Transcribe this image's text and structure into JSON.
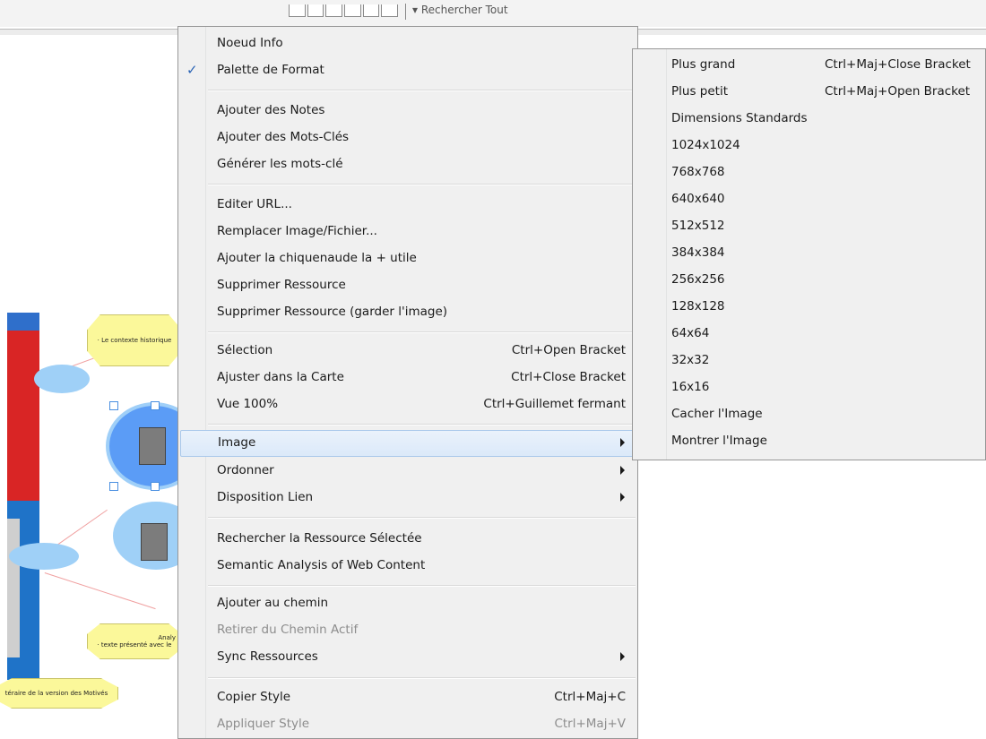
{
  "toolbar": {
    "search_label": "▾ Rechercher Tout"
  },
  "map": {
    "node_texts": [
      "· Le contexte historique",
      "Analy",
      "· texte présenté avec le",
      "téraire de la version des Motivés"
    ]
  },
  "menu": {
    "items": [
      {
        "label": "Noeud Info"
      },
      {
        "label": "Palette de Format",
        "checked": true
      },
      {
        "label": "Ajouter des Notes"
      },
      {
        "label": "Ajouter des Mots-Clés"
      },
      {
        "label": "Générer les mots-clé"
      },
      {
        "label": "Editer URL..."
      },
      {
        "label": "Remplacer Image/Fichier..."
      },
      {
        "label": "Ajouter la chiquenaude la + utile"
      },
      {
        "label": "Supprimer Ressource"
      },
      {
        "label": "Supprimer Ressource (garder l'image)"
      },
      {
        "label": "Sélection",
        "shortcut": "Ctrl+Open Bracket"
      },
      {
        "label": "Ajuster dans la Carte",
        "shortcut": "Ctrl+Close Bracket"
      },
      {
        "label": "Vue 100%",
        "shortcut": "Ctrl+Guillemet fermant"
      },
      {
        "label": "Image",
        "submenu": true,
        "highlighted": true
      },
      {
        "label": "Ordonner",
        "submenu": true
      },
      {
        "label": "Disposition Lien",
        "submenu": true
      },
      {
        "label": "Rechercher la Ressource Sélectée"
      },
      {
        "label": "Semantic Analysis of Web Content"
      },
      {
        "label": "Ajouter au chemin"
      },
      {
        "label": "Retirer du Chemin Actif",
        "disabled": true
      },
      {
        "label": "Sync Ressources",
        "submenu": true
      },
      {
        "label": "Copier Style",
        "shortcut": "Ctrl+Maj+C"
      },
      {
        "label": "Appliquer Style",
        "shortcut": "Ctrl+Maj+V",
        "disabled": true
      }
    ]
  },
  "submenu": {
    "items": [
      {
        "label": "Plus grand",
        "shortcut": "Ctrl+Maj+Close Bracket"
      },
      {
        "label": "Plus petit",
        "shortcut": "Ctrl+Maj+Open Bracket"
      },
      {
        "label": "Dimensions Standards"
      },
      {
        "label": "1024x1024"
      },
      {
        "label": "768x768"
      },
      {
        "label": "640x640"
      },
      {
        "label": "512x512"
      },
      {
        "label": "384x384"
      },
      {
        "label": "256x256"
      },
      {
        "label": "128x128"
      },
      {
        "label": "64x64"
      },
      {
        "label": "32x32"
      },
      {
        "label": "16x16"
      },
      {
        "label": "Cacher l'Image"
      },
      {
        "label": "Montrer l'Image"
      }
    ]
  }
}
